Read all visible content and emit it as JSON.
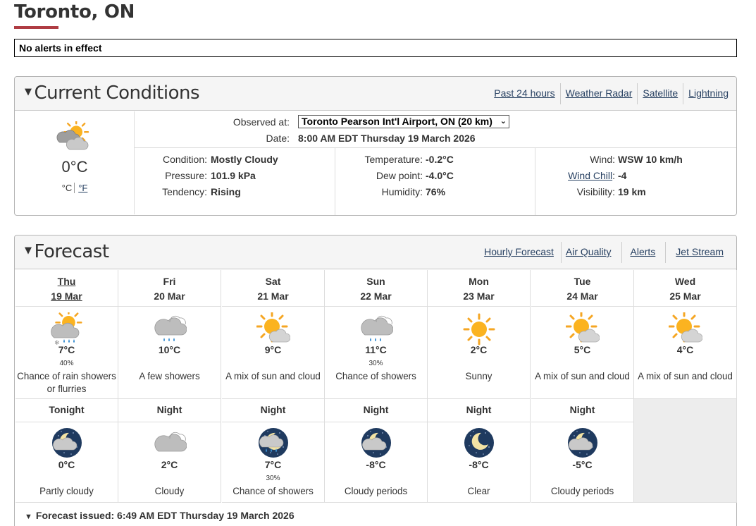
{
  "page": {
    "title": "Toronto, ON"
  },
  "alert": {
    "text": "No alerts in effect"
  },
  "current": {
    "heading": "Current Conditions",
    "links": [
      "Past 24 hours",
      "Weather Radar",
      "Satellite",
      "Lightning"
    ],
    "icon": "mostly-cloudy-icon",
    "temp": "0°C",
    "unit_c": "°C",
    "unit_f": "°F",
    "observed_label": "Observed at:",
    "observed_value": "Toronto Pearson Int'l Airport, ON (20 km)",
    "date_label": "Date:",
    "date_value": "8:00 AM EDT Thursday 19 March 2026",
    "condition_label": "Condition:",
    "condition_value": "Mostly Cloudy",
    "pressure_label": "Pressure:",
    "pressure_value": "101.9 kPa",
    "tendency_label": "Tendency:",
    "tendency_value": "Rising",
    "temperature_label": "Temperature:",
    "temperature_value": "-0.2°C",
    "dewpoint_label": "Dew point:",
    "dewpoint_value": "-4.0°C",
    "humidity_label": "Humidity:",
    "humidity_value": "76%",
    "wind_label": "Wind:",
    "wind_value": "WSW 10 km/h",
    "windchill_label": "Wind Chill",
    "windchill_value": "-4",
    "visibility_label": "Visibility:",
    "visibility_value": "19 km"
  },
  "forecast": {
    "heading": "Forecast",
    "links": [
      "Hourly Forecast",
      "Air Quality",
      "Alerts",
      "Jet Stream"
    ],
    "days": [
      {
        "day": "Thu",
        "date": "19 Mar",
        "icon": "sun-cloud-rain-snow-icon",
        "temp": "7°C",
        "pop": "40%",
        "desc": "Chance of rain showers or flurries"
      },
      {
        "day": "Fri",
        "date": "20 Mar",
        "icon": "cloud-rain-icon",
        "temp": "10°C",
        "pop": "",
        "desc": "A few showers"
      },
      {
        "day": "Sat",
        "date": "21 Mar",
        "icon": "sun-cloud-icon",
        "temp": "9°C",
        "pop": "",
        "desc": "A mix of sun and cloud"
      },
      {
        "day": "Sun",
        "date": "22 Mar",
        "icon": "cloud-rain-icon",
        "temp": "11°C",
        "pop": "30%",
        "desc": "Chance of showers"
      },
      {
        "day": "Mon",
        "date": "23 Mar",
        "icon": "sun-icon",
        "temp": "2°C",
        "pop": "",
        "desc": "Sunny"
      },
      {
        "day": "Tue",
        "date": "24 Mar",
        "icon": "sun-cloud-icon",
        "temp": "5°C",
        "pop": "",
        "desc": "A mix of sun and cloud"
      },
      {
        "day": "Wed",
        "date": "25 Mar",
        "icon": "sun-cloud-icon",
        "temp": "4°C",
        "pop": "",
        "desc": "A mix of sun and cloud"
      }
    ],
    "nights": [
      {
        "label": "Tonight",
        "icon": "moon-cloud-icon",
        "temp": "0°C",
        "pop": "",
        "desc": "Partly cloudy"
      },
      {
        "label": "Night",
        "icon": "cloud-icon",
        "temp": "2°C",
        "pop": "",
        "desc": "Cloudy"
      },
      {
        "label": "Night",
        "icon": "moon-cloud-rain-icon",
        "temp": "7°C",
        "pop": "30%",
        "desc": "Chance of showers"
      },
      {
        "label": "Night",
        "icon": "moon-cloud-icon",
        "temp": "-8°C",
        "pop": "",
        "desc": "Cloudy periods"
      },
      {
        "label": "Night",
        "icon": "moon-clear-icon",
        "temp": "-8°C",
        "pop": "",
        "desc": "Clear"
      },
      {
        "label": "Night",
        "icon": "moon-cloud-icon",
        "temp": "-5°C",
        "pop": "",
        "desc": "Cloudy periods"
      }
    ],
    "issued": "Forecast issued: 6:49 AM EDT Thursday 19 March 2026"
  }
}
